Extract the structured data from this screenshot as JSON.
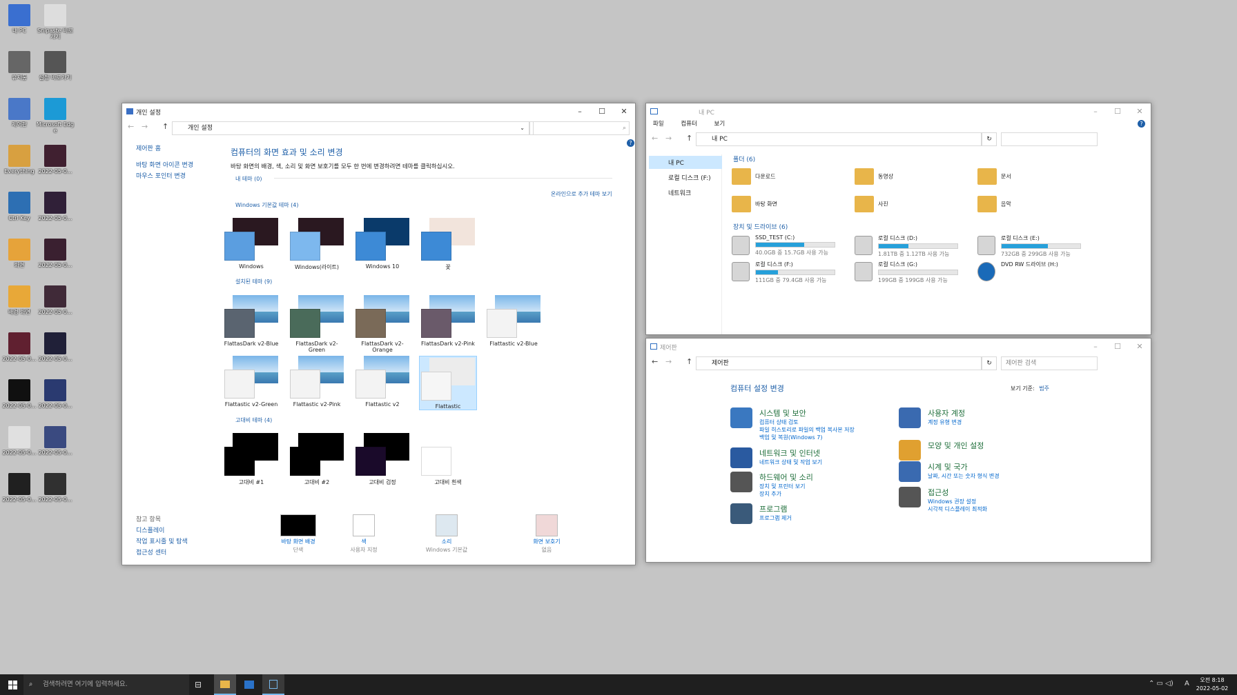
{
  "desktop": {
    "icons": [
      "내 PC",
      "Snipaste 바로가기",
      "휴지통",
      "설정 바로가기",
      "제어판",
      "Microsoft Edge",
      "Everything",
      "2022-05-0...",
      "Ctrl Key",
      "2022-05-0...",
      "화면",
      "2022-05-0...",
      "배경 화면",
      "2022-05-0...",
      "2022-05-0...",
      "2022-05-0...",
      "2022-05-0...",
      "2022-05-0...",
      "2022-05-0...",
      "2022-05-0...",
      "2022-05-0...",
      "2022-05-0..."
    ]
  },
  "personal": {
    "title": "개인 설정",
    "address": "개인 설정",
    "sidebar": {
      "home": "제어판 홈",
      "links": [
        "바탕 화면 아이콘 변경",
        "마우스 포인터 변경"
      ],
      "see_also": "참고 항목",
      "see_links": [
        "디스플레이",
        "작업 표시줄 및 탐색",
        "접근성 센터"
      ]
    },
    "heading": "컴퓨터의 화면 효과 및 소리 변경",
    "desc": "바탕 화면의 배경, 색, 소리 및 화면 보호기를 모두 한 번에 변경하려면 테마를 클릭하십시오.",
    "my_themes": "내 테마 (0)",
    "online": "온라인으로 추가 테마 보기",
    "default_hdr": "Windows 기본값 테마 (4)",
    "default_themes": [
      "Windows",
      "Windows(라이트)",
      "Windows 10",
      "꽃"
    ],
    "installed_hdr": "설치된 테마 (9)",
    "installed_themes": [
      "FlattasDark v2-Blue",
      "FlattasDark v2-Green",
      "FlattasDark v2-Orange",
      "FlattasDark v2-Pink",
      "Flattastic v2-Blue",
      "Flattastic v2-Green",
      "Flattastic v2-Pink",
      "Flattastic v2",
      "Flattastic"
    ],
    "hc_hdr": "고대비 테마 (4)",
    "hc_themes": [
      "고대비 #1",
      "고대비 #2",
      "고대비 검정",
      "고대비 흰색"
    ],
    "bottom": [
      {
        "label": "바탕 화면 배경",
        "sub": "단색"
      },
      {
        "label": "색",
        "sub": "사용자 지정"
      },
      {
        "label": "소리",
        "sub": "Windows 기본값"
      },
      {
        "label": "화면 보호기",
        "sub": "없음"
      }
    ]
  },
  "explorer": {
    "title": "내 PC",
    "menu": [
      "파일",
      "컴퓨터",
      "보기"
    ],
    "address": "내 PC",
    "nav": [
      "내 PC",
      "로컬 디스크 (F:)",
      "네트워크"
    ],
    "folders_hdr": "폴더 (6)",
    "folders": [
      "다운로드",
      "동영상",
      "문서",
      "바탕 화면",
      "사진",
      "음악"
    ],
    "drives_hdr": "장치 및 드라이브 (6)",
    "drives": [
      {
        "name": "SSD_TEST (C:)",
        "info": "40.0GB 중 15.7GB 사용 가능",
        "used": 0.61
      },
      {
        "name": "로컬 디스크 (D:)",
        "info": "1.81TB 중 1.12TB 사용 가능",
        "used": 0.38
      },
      {
        "name": "로컬 디스크 (E:)",
        "info": "732GB 중 299GB 사용 가능",
        "used": 0.59
      },
      {
        "name": "로컬 디스크 (F:)",
        "info": "111GB 중 79.4GB 사용 가능",
        "used": 0.28
      },
      {
        "name": "로컬 디스크 (G:)",
        "info": "199GB 중 199GB 사용 가능",
        "used": 0.0
      },
      {
        "name": "DVD RW 드라이브 (H:)",
        "info": "",
        "used": null
      }
    ]
  },
  "control": {
    "title": "제어판",
    "address": "제어판",
    "search_placeholder": "제어판 검색",
    "heading": "컴퓨터 설정 변경",
    "viewby": "보기 기준:",
    "viewby_value": "범주",
    "left": [
      {
        "title": "시스템 및 보안",
        "subs": [
          "컴퓨터 상태 검토",
          "파일 히스토리로 파일의 백업 복사본 저장",
          "백업 및 복원(Windows 7)"
        ]
      },
      {
        "title": "네트워크 및 인터넷",
        "subs": [
          "네트워크 상태 및 작업 보기"
        ]
      },
      {
        "title": "하드웨어 및 소리",
        "subs": [
          "장치 및 프린터 보기",
          "장치 추가"
        ]
      },
      {
        "title": "프로그램",
        "subs": [
          "프로그램 제거"
        ]
      }
    ],
    "right": [
      {
        "title": "사용자 계정",
        "subs": [
          "계정 유형 변경"
        ]
      },
      {
        "title": "모양 및 개인 설정",
        "subs": []
      },
      {
        "title": "시계 및 국가",
        "subs": [
          "날짜, 시간 또는 숫자 형식 변경"
        ]
      },
      {
        "title": "접근성",
        "subs": [
          "Windows 권장 설정",
          "시각적 디스플레이 최적화"
        ]
      }
    ]
  },
  "taskbar": {
    "search_placeholder": "검색하려면 여기에 입력하세요.",
    "time": "오전 8:18",
    "date": "2022-05-02",
    "lang": "A"
  }
}
